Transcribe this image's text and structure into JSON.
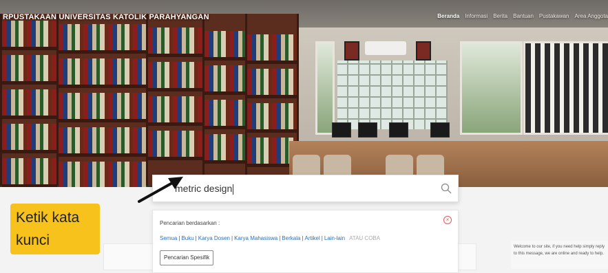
{
  "header": {
    "site_title": "RPUSTAKAAN UNIVERSITAS KATOLIK PARAHYANGAN",
    "nav": [
      "Beranda",
      "Informasi",
      "Berita",
      "Bantuan",
      "Pustakawan",
      "Area Anggota"
    ]
  },
  "search": {
    "query": "metric design",
    "icon": "search-icon"
  },
  "panel": {
    "title": "Pencarian berdasarkan :",
    "filters": [
      "Semua",
      "Buku",
      "Karya Dosen",
      "Karya Mahasiswa",
      "Berkala",
      "Artikel",
      "Lain-lain"
    ],
    "atau_label": "ATAU COBA",
    "specific_button": "Pencarian Spesifik",
    "close_icon": "close-circle-icon"
  },
  "callout": {
    "line1": "Ketik kata",
    "line2": "kunci"
  },
  "chat": {
    "text": "Welcome to our site, if you need help simply reply to this message, we are online and ready to help."
  },
  "colors": {
    "callout_bg": "#f6c21b",
    "link": "#2f6fb0",
    "close": "#e05a5a"
  }
}
